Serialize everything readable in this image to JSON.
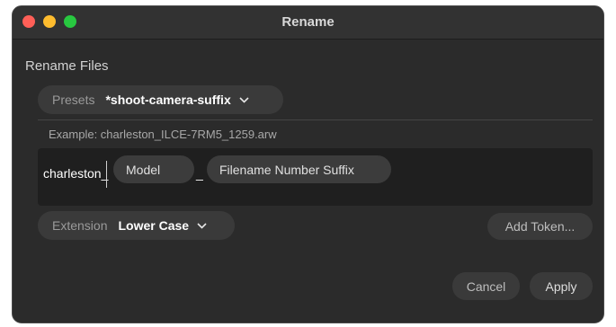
{
  "window": {
    "title": "Rename"
  },
  "section": {
    "label": "Rename Files"
  },
  "presets": {
    "label": "Presets",
    "value": "*shoot-camera-suffix",
    "chevron": "chevron-down-icon"
  },
  "example": {
    "text": "Example: charleston_ILCE-7RM5_1259.arw"
  },
  "editor": {
    "literal_prefix": "charleston_",
    "token_model": "Model",
    "separator": "_",
    "token_suffix": "Filename Number Suffix"
  },
  "extension": {
    "label": "Extension",
    "value": "Lower Case",
    "chevron": "chevron-down-icon"
  },
  "buttons": {
    "add_token": "Add Token...",
    "cancel": "Cancel",
    "apply": "Apply"
  },
  "colors": {
    "background": "#2b2b2b",
    "close": "#ff5f57",
    "minimize": "#febc2e",
    "maximize": "#28c840"
  }
}
